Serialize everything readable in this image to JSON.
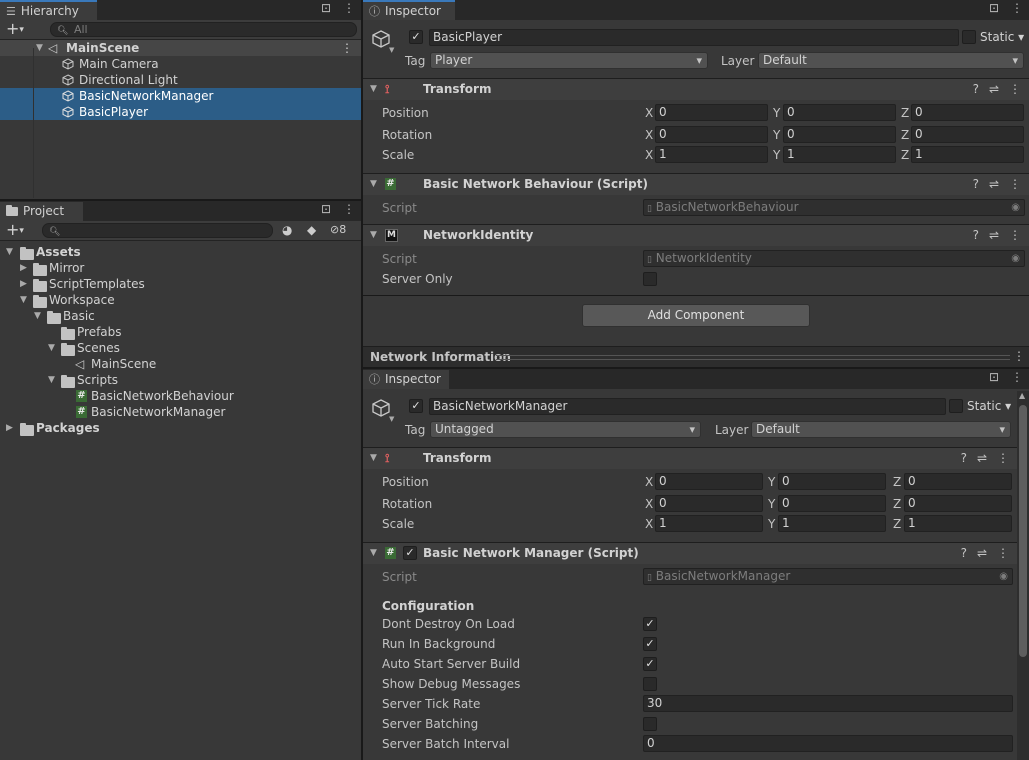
{
  "hierarchy": {
    "tab_label": "Hierarchy",
    "search_placeholder": "All",
    "scene_name": "MainScene",
    "items": [
      {
        "label": "Main Camera"
      },
      {
        "label": "Directional Light"
      },
      {
        "label": "BasicNetworkManager"
      },
      {
        "label": "BasicPlayer"
      }
    ]
  },
  "project": {
    "tab_label": "Project",
    "hidden_count": "8",
    "tree": [
      {
        "label": "Assets"
      },
      {
        "label": "Mirror"
      },
      {
        "label": "ScriptTemplates"
      },
      {
        "label": "Workspace"
      },
      {
        "label": "Basic"
      },
      {
        "label": "Prefabs"
      },
      {
        "label": "Scenes"
      },
      {
        "label": "MainScene"
      },
      {
        "label": "Scripts"
      },
      {
        "label": "BasicNetworkBehaviour"
      },
      {
        "label": "BasicNetworkManager"
      },
      {
        "label": "Packages"
      }
    ]
  },
  "inspector1": {
    "tab_label": "Inspector",
    "object_name": "BasicPlayer",
    "static_label": "Static",
    "tag_label": "Tag",
    "tag_value": "Player",
    "layer_label": "Layer",
    "layer_value": "Default",
    "transform": {
      "title": "Transform",
      "position_label": "Position",
      "rotation_label": "Rotation",
      "scale_label": "Scale",
      "x": "X",
      "y": "Y",
      "z": "Z",
      "position": [
        "0",
        "0",
        "0"
      ],
      "rotation": [
        "0",
        "0",
        "0"
      ],
      "scale": [
        "1",
        "1",
        "1"
      ]
    },
    "behaviour": {
      "title": "Basic Network Behaviour (Script)",
      "script_label": "Script",
      "script_value": "BasicNetworkBehaviour"
    },
    "identity": {
      "title": "NetworkIdentity",
      "script_label": "Script",
      "script_value": "NetworkIdentity",
      "server_only_label": "Server Only"
    },
    "add_component": "Add Component",
    "network_info": "Network Information"
  },
  "inspector2": {
    "tab_label": "Inspector",
    "object_name": "BasicNetworkManager",
    "static_label": "Static",
    "tag_label": "Tag",
    "tag_value": "Untagged",
    "layer_label": "Layer",
    "layer_value": "Default",
    "transform": {
      "title": "Transform",
      "position_label": "Position",
      "rotation_label": "Rotation",
      "scale_label": "Scale",
      "x": "X",
      "y": "Y",
      "z": "Z",
      "position": [
        "0",
        "0",
        "0"
      ],
      "rotation": [
        "0",
        "0",
        "0"
      ],
      "scale": [
        "1",
        "1",
        "1"
      ]
    },
    "manager": {
      "title": "Basic Network Manager (Script)",
      "script_label": "Script",
      "script_value": "BasicNetworkManager",
      "configuration": "Configuration",
      "dont_destroy": "Dont Destroy On Load",
      "run_in_background": "Run In Background",
      "auto_start": "Auto Start Server Build",
      "show_debug": "Show Debug Messages",
      "tick_rate_label": "Server Tick Rate",
      "tick_rate_value": "30",
      "batching_label": "Server Batching",
      "batch_interval_label": "Server Batch Interval",
      "batch_interval_value": "0"
    }
  },
  "icons": {
    "check": "✓",
    "kebab": "⋮",
    "lock": "🔒",
    "help": "?",
    "sliders": "⇄",
    "plus": "+",
    "tri_down": "▼",
    "tri_right": "▶"
  }
}
